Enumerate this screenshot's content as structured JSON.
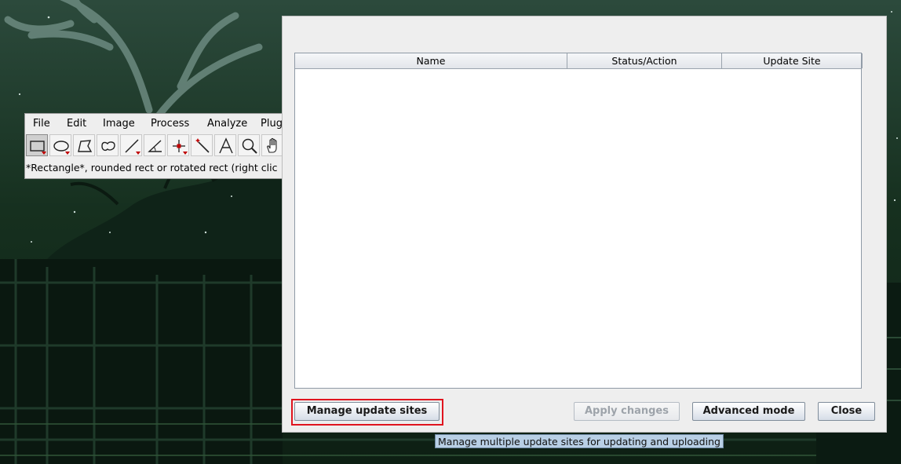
{
  "imagej": {
    "menu": [
      "File",
      "Edit",
      "Image",
      "Process",
      "Analyze",
      "Plug"
    ],
    "tools": [
      {
        "icon": "rectangle-icon",
        "selected": true,
        "has_submenu": true
      },
      {
        "icon": "oval-icon",
        "selected": false,
        "has_submenu": true
      },
      {
        "icon": "polygon-icon",
        "selected": false,
        "has_submenu": false
      },
      {
        "icon": "freehand-icon",
        "selected": false,
        "has_submenu": false
      },
      {
        "icon": "line-icon",
        "selected": false,
        "has_submenu": true
      },
      {
        "icon": "angle-icon",
        "selected": false,
        "has_submenu": false
      },
      {
        "icon": "point-icon",
        "selected": false,
        "has_submenu": true
      },
      {
        "icon": "wand-icon",
        "selected": false,
        "has_submenu": false
      },
      {
        "icon": "text-icon",
        "selected": false,
        "has_submenu": false
      },
      {
        "icon": "magnifier-icon",
        "selected": false,
        "has_submenu": false
      },
      {
        "icon": "hand-icon",
        "selected": false,
        "has_submenu": false
      }
    ],
    "status": "*Rectangle*, rounded rect or rotated rect (right clic"
  },
  "updater": {
    "table": {
      "columns": [
        "Name",
        "Status/Action",
        "Update Site"
      ],
      "rows": []
    },
    "buttons": {
      "manage": "Manage update sites",
      "apply": "Apply changes",
      "advanced": "Advanced mode",
      "close": "Close"
    },
    "apply_enabled": false,
    "tooltip": "Manage multiple update sites for updating and uploading"
  },
  "colors": {
    "highlight": "#e0141e",
    "tooltip_bg": "#b8cfe5",
    "desktop": "#12261a"
  }
}
